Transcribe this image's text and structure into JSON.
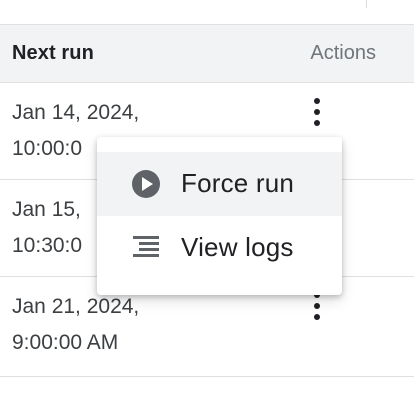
{
  "table": {
    "headers": {
      "next_run": "Next run",
      "actions": "Actions"
    },
    "rows": [
      {
        "next_run": "Jan 14, 2024,\n10:00:0"
      },
      {
        "next_run": "Jan 15,\n10:30:0"
      },
      {
        "next_run": "Jan 21, 2024,\n9:00:00 AM"
      }
    ]
  },
  "menu": {
    "items": [
      {
        "label": "Force run",
        "icon": "play-circle-icon"
      },
      {
        "label": "View logs",
        "icon": "list-lines-icon"
      }
    ]
  }
}
